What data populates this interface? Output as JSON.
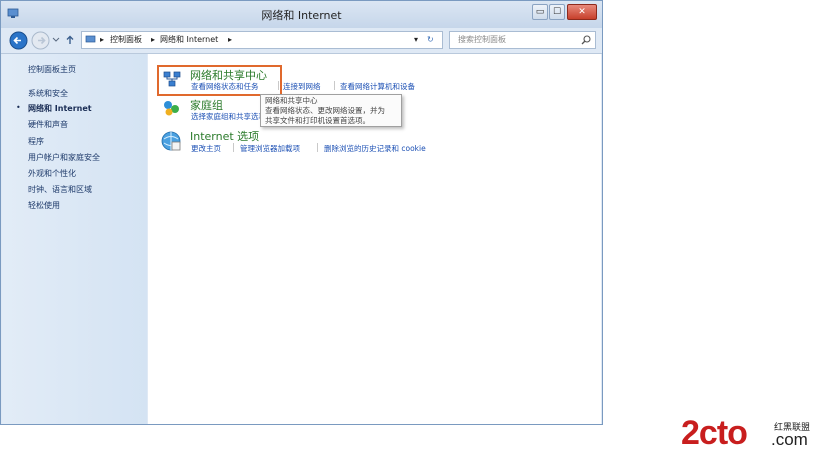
{
  "window": {
    "title": "网络和 Internet"
  },
  "buttons": {
    "minimize": "▭",
    "maximize": "☐",
    "close": "✕",
    "refresh": "↻",
    "dropdown": "▾"
  },
  "address": {
    "root": "控制面板",
    "current": "网络和 Internet"
  },
  "search": {
    "placeholder": "搜索控制面板"
  },
  "sidebar": {
    "items": [
      {
        "label": "控制面板主页"
      },
      {
        "label": "系统和安全"
      },
      {
        "label": "网络和 Internet",
        "active": true
      },
      {
        "label": "硬件和声音"
      },
      {
        "label": "程序"
      },
      {
        "label": "用户帐户和家庭安全"
      },
      {
        "label": "外观和个性化"
      },
      {
        "label": "时钟、语言和区域"
      },
      {
        "label": "轻松使用"
      }
    ],
    "bullet": "•"
  },
  "categories": [
    {
      "title": "网络和共享中心",
      "links": [
        "查看网络状态和任务",
        "连接到网络",
        "查看网络计算机和设备"
      ]
    },
    {
      "title": "家庭组",
      "links": [
        "选择家庭组和共享选项"
      ]
    },
    {
      "title": "Internet 选项",
      "links": [
        "更改主页",
        "管理浏览器加载项",
        "删除浏览的历史记录和 cookie"
      ]
    }
  ],
  "tooltip": {
    "line1": "网络和共享中心",
    "line2": "查看网络状态、更改网络设置，并为",
    "line3": "共享文件和打印机设置首选项。"
  },
  "watermark": {
    "brand": "2cto",
    "suffix": ".com",
    "cn": "红黑联盟"
  },
  "colors": {
    "accent_orange": "#e0692d",
    "link_blue": "#1c50b4",
    "title_green": "#2a7a2a",
    "watermark_red": "#c81e1e"
  }
}
